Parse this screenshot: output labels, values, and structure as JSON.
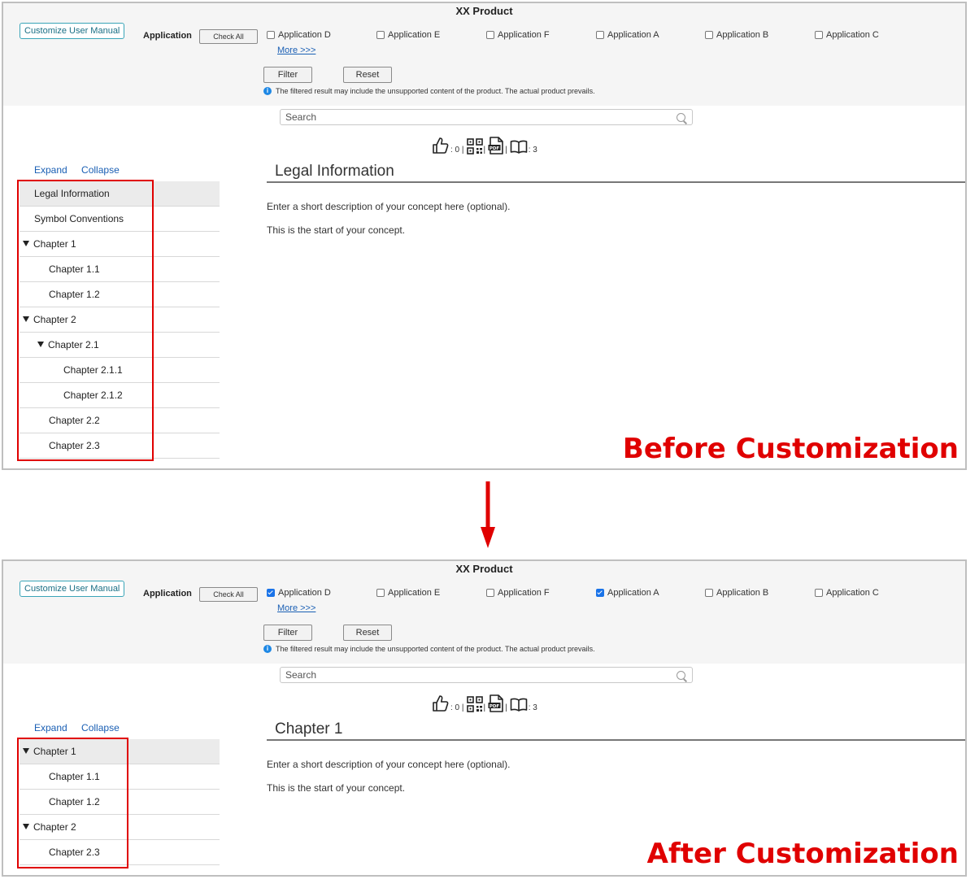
{
  "panels": [
    {
      "title": "XX Product",
      "customize_label": "Customize User Manual",
      "application_label": "Application",
      "check_all_label": "Check All",
      "applications": [
        {
          "label": "Application D",
          "checked": false
        },
        {
          "label": "Application E",
          "checked": false
        },
        {
          "label": "Application F",
          "checked": false
        },
        {
          "label": "Application A",
          "checked": false
        },
        {
          "label": "Application B",
          "checked": false
        },
        {
          "label": "Application C",
          "checked": false
        }
      ],
      "more_label": "More >>>",
      "filter_label": "Filter",
      "reset_label": "Reset",
      "note": "The filtered result may include the unsupported content of the product. The actual product prevails.",
      "search_placeholder": "Search",
      "like_count": ": 0 |",
      "sep": "|",
      "sep2": "|",
      "book_count": ": 3",
      "expand_label": "Expand",
      "collapse_label": "Collapse",
      "tree": [
        {
          "label": "Legal Information",
          "level": 0,
          "expander": false,
          "selected": true
        },
        {
          "label": "Symbol Conventions",
          "level": 0,
          "expander": false,
          "selected": false
        },
        {
          "label": "Chapter 1",
          "level": 0,
          "expander": true,
          "selected": false
        },
        {
          "label": "Chapter 1.1",
          "level": 1,
          "expander": false,
          "selected": false
        },
        {
          "label": "Chapter 1.2",
          "level": 1,
          "expander": false,
          "selected": false
        },
        {
          "label": "Chapter 2",
          "level": 0,
          "expander": true,
          "selected": false
        },
        {
          "label": "Chapter 2.1",
          "level": 1,
          "expander": true,
          "selected": false
        },
        {
          "label": "Chapter 2.1.1",
          "level": 2,
          "expander": false,
          "selected": false
        },
        {
          "label": "Chapter 2.1.2",
          "level": 2,
          "expander": false,
          "selected": false
        },
        {
          "label": "Chapter 2.2",
          "level": 1,
          "expander": false,
          "selected": false
        },
        {
          "label": "Chapter 2.3",
          "level": 1,
          "expander": false,
          "selected": false
        }
      ],
      "content_title": "Legal Information",
      "content_desc": "Enter a short description of your concept here (optional).",
      "content_body": "This is the start of your concept.",
      "caption": "Before Customization"
    },
    {
      "title": "XX Product",
      "customize_label": "Customize User Manual",
      "application_label": "Application",
      "check_all_label": "Check All",
      "applications": [
        {
          "label": "Application D",
          "checked": true
        },
        {
          "label": "Application E",
          "checked": false
        },
        {
          "label": "Application F",
          "checked": false
        },
        {
          "label": "Application A",
          "checked": true
        },
        {
          "label": "Application B",
          "checked": false
        },
        {
          "label": "Application C",
          "checked": false
        }
      ],
      "more_label": "More >>>",
      "filter_label": "Filter",
      "reset_label": "Reset",
      "note": "The filtered result may include the unsupported content of the product. The actual product prevails.",
      "search_placeholder": "Search",
      "like_count": ": 0 |",
      "sep": "|",
      "sep2": "|",
      "book_count": ": 3",
      "expand_label": "Expand",
      "collapse_label": "Collapse",
      "tree": [
        {
          "label": "Chapter 1",
          "level": 0,
          "expander": true,
          "selected": true
        },
        {
          "label": "Chapter 1.1",
          "level": 1,
          "expander": false,
          "selected": false
        },
        {
          "label": "Chapter 1.2",
          "level": 1,
          "expander": false,
          "selected": false
        },
        {
          "label": "Chapter 2",
          "level": 0,
          "expander": true,
          "selected": false
        },
        {
          "label": "Chapter 2.3",
          "level": 1,
          "expander": false,
          "selected": false
        }
      ],
      "content_title": "Chapter 1",
      "content_desc": "Enter a short description of your concept here (optional).",
      "content_body": "This is the start of your concept.",
      "caption": "After Customization"
    }
  ],
  "colors": {
    "highlight": "#e00000",
    "link": "#1a5fb4",
    "accent": "#3aa5b8"
  }
}
